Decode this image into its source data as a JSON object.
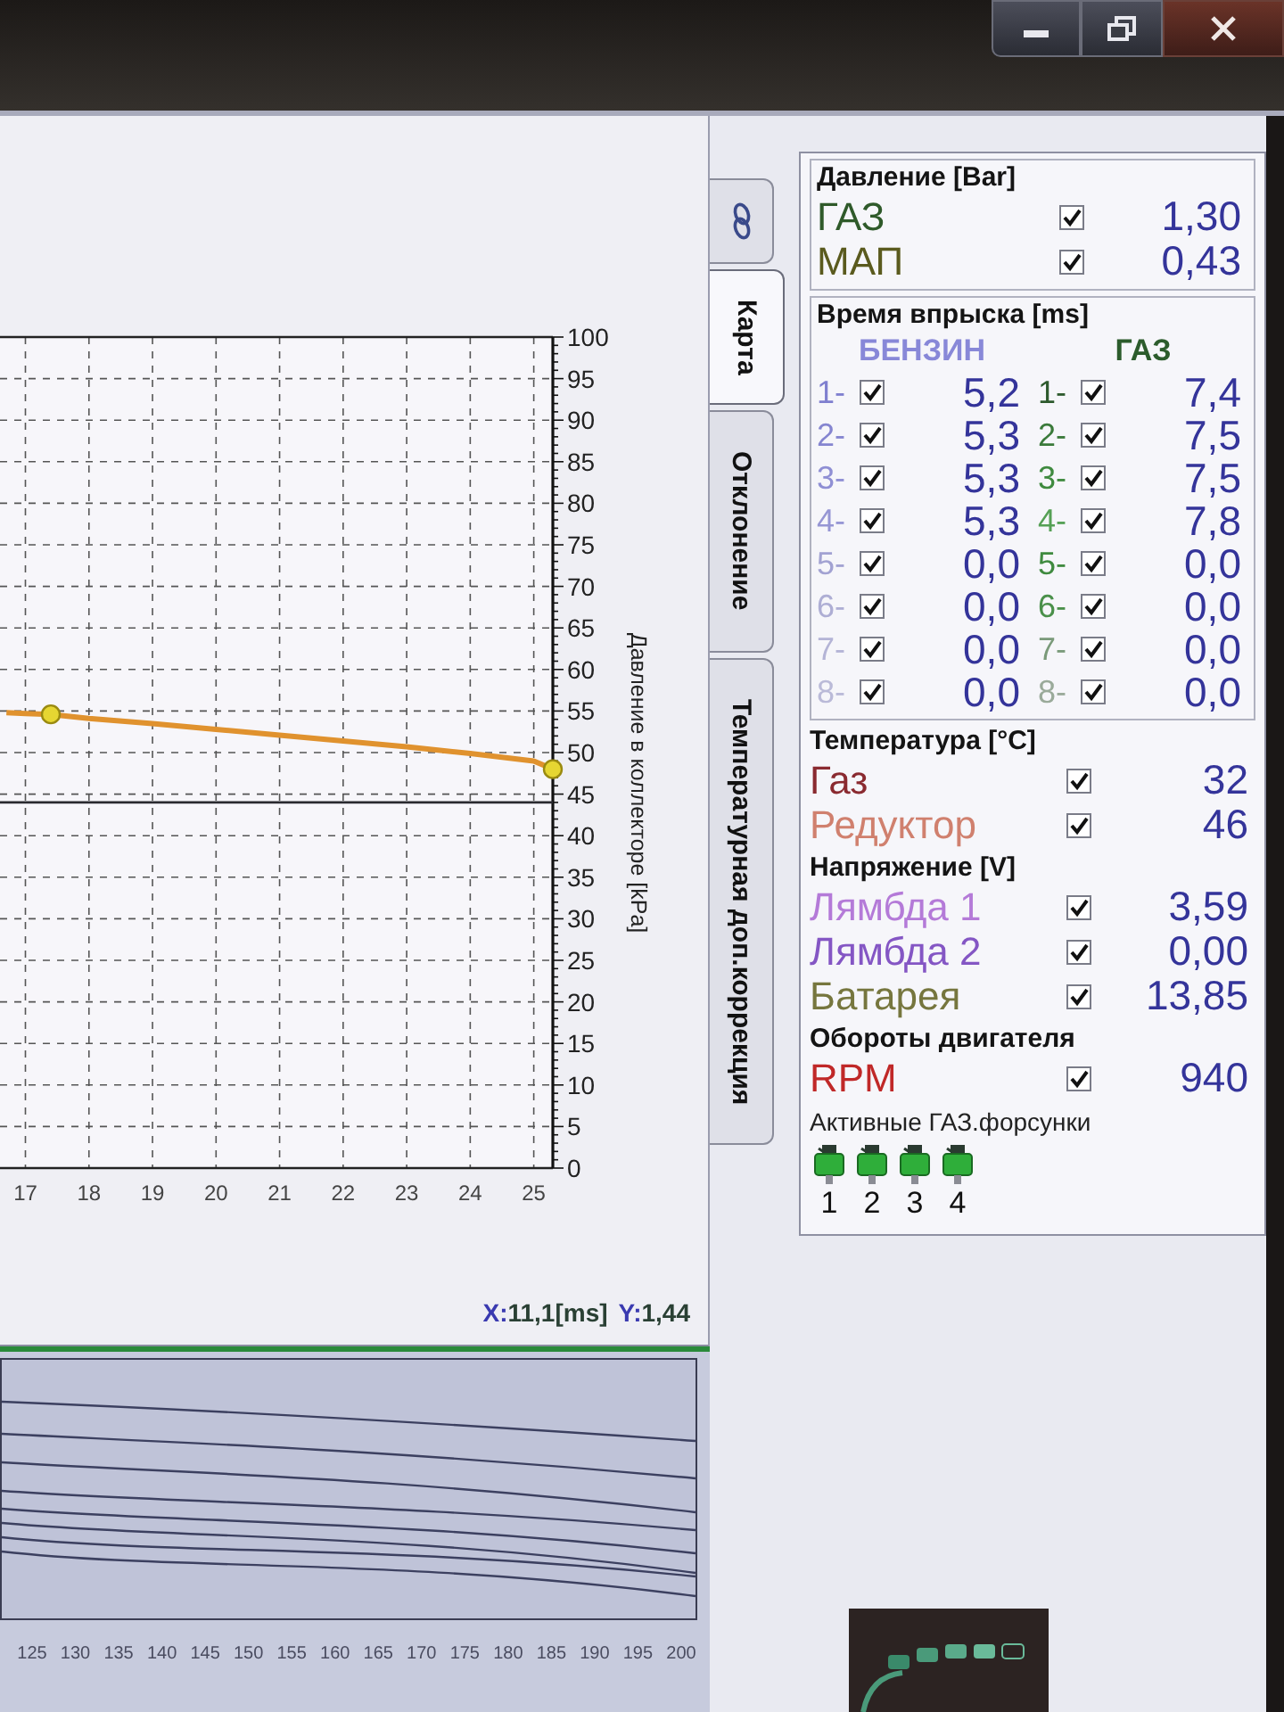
{
  "tabs": [
    {
      "kind": "icon",
      "selected": false
    },
    {
      "kind": "text",
      "label": "Карта",
      "selected": true
    },
    {
      "kind": "text",
      "label": "Отклонение",
      "selected": false
    },
    {
      "kind": "text",
      "label": "Температурная доп.коррекция",
      "selected": false
    }
  ],
  "map_chart": {
    "chart_data": {
      "type": "line",
      "ylabel": "Давление в коллекторе [kPa]",
      "x": [
        16.7,
        17,
        17.4,
        18,
        19,
        20,
        21,
        22,
        23,
        24,
        25,
        25.3
      ],
      "series": [
        {
          "color": "#e0922e",
          "values": [
            54.8,
            54.7,
            54.6,
            54.1,
            53.5,
            52.8,
            52.1,
            51.4,
            50.7,
            49.9,
            49,
            48
          ]
        }
      ],
      "xlim": [
        16.6,
        25.3
      ],
      "ylim": [
        0,
        100
      ],
      "xticks": [
        17,
        18,
        19,
        20,
        21,
        22,
        23,
        24,
        25
      ],
      "yticks": [
        0,
        5,
        10,
        15,
        20,
        25,
        30,
        35,
        40,
        45,
        50,
        55,
        60,
        65,
        70,
        75,
        80,
        85,
        90,
        95,
        100
      ],
      "grid": true,
      "ref_lines": [
        {
          "axis": "y",
          "value": 44,
          "color": "#2a2a30"
        }
      ]
    },
    "cursor_readout": {
      "x_label": "X:",
      "x_value": "11,1[ms]",
      "y_label": "Y:",
      "y_value": "1,44"
    }
  },
  "trend_chart": {
    "x_labels": [
      "125",
      "130",
      "135",
      "140",
      "145",
      "150",
      "155",
      "160",
      "165",
      "170",
      "175",
      "180",
      "185",
      "190",
      "195",
      "200"
    ]
  },
  "pressure": {
    "title": "Давление [Bar]",
    "sensors": [
      {
        "name": "ГАЗ",
        "color": "#2f5a2a",
        "checked": true,
        "value": "1,30"
      },
      {
        "name": "МАП",
        "color": "#5a5a1e",
        "checked": true,
        "value": "0,43"
      }
    ]
  },
  "injection": {
    "title": "Время впрыска [ms]",
    "columns": [
      {
        "header": "БЕНЗИН",
        "color": "#8888d8",
        "injectors": [
          {
            "label": "1-",
            "color": "#7f7fcf",
            "checked": true,
            "value": "5,2"
          },
          {
            "label": "2-",
            "color": "#8585d0",
            "checked": true,
            "value": "5,3"
          },
          {
            "label": "3-",
            "color": "#8f8fd4",
            "checked": true,
            "value": "5,3"
          },
          {
            "label": "4-",
            "color": "#9696d4",
            "checked": true,
            "value": "5,3"
          },
          {
            "label": "5-",
            "color": "#a2a2d2",
            "checked": true,
            "value": "0,0"
          },
          {
            "label": "6-",
            "color": "#aeaed4",
            "checked": true,
            "value": "0,0"
          },
          {
            "label": "7-",
            "color": "#b4b4d6",
            "checked": true,
            "value": "0,0"
          },
          {
            "label": "8-",
            "color": "#babad8",
            "checked": true,
            "value": "0,0"
          }
        ]
      },
      {
        "header": "ГАЗ",
        "color": "#2c5c2c",
        "injectors": [
          {
            "label": "1-",
            "color": "#2d5a2d",
            "checked": true,
            "value": "7,4"
          },
          {
            "label": "2-",
            "color": "#3a7a3a",
            "checked": true,
            "value": "7,5"
          },
          {
            "label": "3-",
            "color": "#3f8a3f",
            "checked": true,
            "value": "7,5"
          },
          {
            "label": "4-",
            "color": "#55a055",
            "checked": true,
            "value": "7,8"
          },
          {
            "label": "5-",
            "color": "#3f8a3f",
            "checked": true,
            "value": "0,0"
          },
          {
            "label": "6-",
            "color": "#4a904a",
            "checked": true,
            "value": "0,0"
          },
          {
            "label": "7-",
            "color": "#7a9a7a",
            "checked": true,
            "value": "0,0"
          },
          {
            "label": "8-",
            "color": "#9aaa9a",
            "checked": true,
            "value": "0,0"
          }
        ]
      }
    ]
  },
  "temperature": {
    "title": "Температура [°C]",
    "sensors": [
      {
        "name": "Газ",
        "color": "#8a2a30",
        "checked": true,
        "value": "32"
      },
      {
        "name": "Редуктор",
        "color": "#d0806e",
        "checked": true,
        "value": "46"
      }
    ]
  },
  "voltage": {
    "title": "Напряжение [V]",
    "sensors": [
      {
        "name": "Лямбда 1",
        "color": "#b47ad8",
        "checked": true,
        "value": "3,59"
      },
      {
        "name": "Лямбда 2",
        "color": "#8456c4",
        "checked": true,
        "value": "0,00"
      },
      {
        "name": "Батарея",
        "color": "#76763e",
        "checked": true,
        "value": "13,85"
      }
    ]
  },
  "engine_speed": {
    "title": "Обороты двигателя",
    "sensors": [
      {
        "name": "RPM",
        "color": "#c02828",
        "checked": true,
        "value": "940"
      }
    ]
  },
  "active_gas_injectors": {
    "title": "Активные ГАЗ.форсунки",
    "injectors": [
      {
        "label": "1",
        "on": true
      },
      {
        "label": "2",
        "on": true
      },
      {
        "label": "3",
        "on": true
      },
      {
        "label": "4",
        "on": true
      }
    ]
  }
}
